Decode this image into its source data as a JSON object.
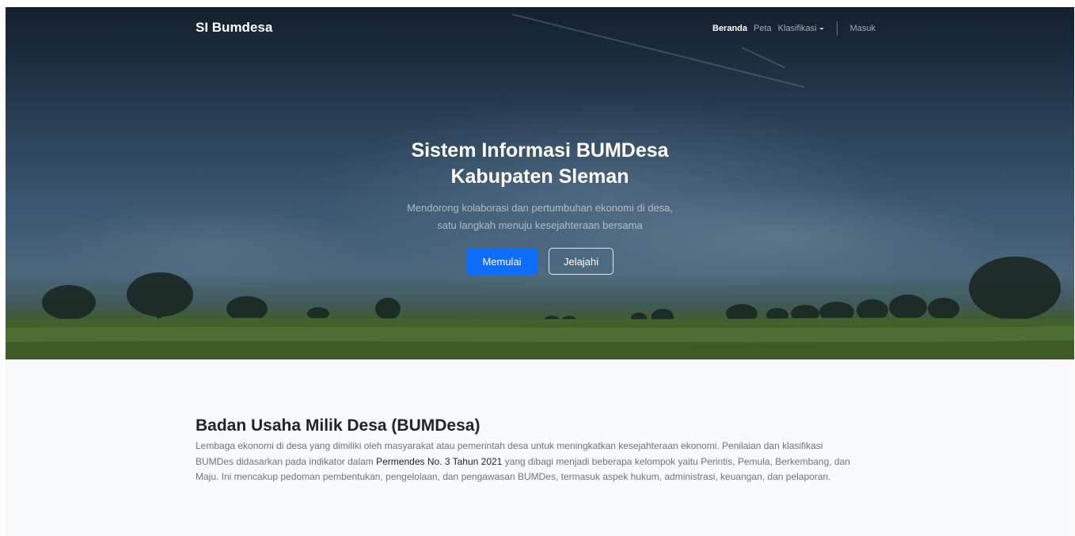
{
  "navbar": {
    "brand": "SI Bumdesa",
    "links": {
      "beranda": "Beranda",
      "peta": "Peta",
      "klasifikasi": "Klasifikasi",
      "masuk": "Masuk"
    },
    "active": "Beranda"
  },
  "hero": {
    "title_line1": "Sistem Informasi BUMDesa",
    "title_line2": "Kabupaten Sleman",
    "subtitle_line1": "Mendorong kolaborasi dan pertumbuhan ekonomi di desa,",
    "subtitle_line2": "satu langkah menuju kesejahteraan bersama",
    "primary_button": "Memulai",
    "secondary_button": "Jelajahi"
  },
  "info": {
    "title": "Badan Usaha Milik Desa (BUMDesa)",
    "text_before": "Lembaga ekonomi di desa yang dimiliki oleh masyarakat atau pemerintah desa untuk meningkatkan kesejahteraan ekonomi. Penilaian dan klasifikasi BUMDes didasarkan pada indikator dalam ",
    "text_emphasis": "Permendes No. 3 Tahun 2021",
    "text_after": " yang dibagi menjadi beberapa kelompok yaitu Perintis, Pemula, Berkembang, dan Maju. Ini mencakup pedoman pembentukan, pengelolaan, dan pengawasan BUMDes, termasuk aspek hukum, administrasi, keuangan, dan pelaporan."
  },
  "colors": {
    "primary": "#0d6efd",
    "section_bg": "#f8f9fa",
    "heading": "#212529",
    "muted_text": "#6c757d"
  }
}
